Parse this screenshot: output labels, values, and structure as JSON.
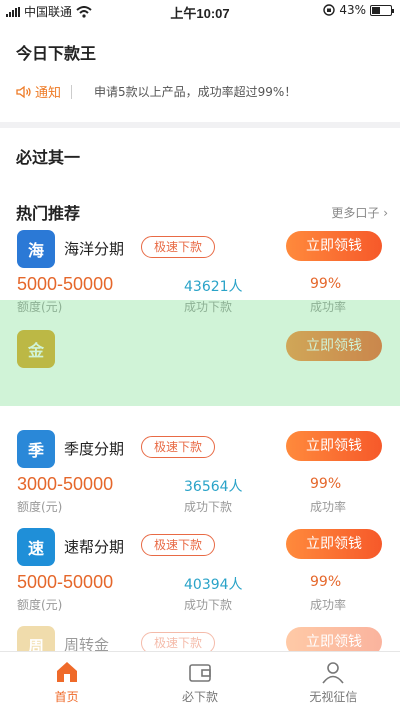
{
  "status": {
    "carrier": "中国联通",
    "time": "上午10:07",
    "battery": "43%",
    "battery_level": 0.43
  },
  "top": {
    "title": "今日下款王",
    "notice_label": "通知",
    "notice_text": "申请5款以上产品，成功率超过99%！"
  },
  "must": {
    "title": "必过其一"
  },
  "hot": {
    "title": "热门推荐",
    "more": "更多口子",
    "labels": {
      "amount": "额度(元)",
      "downloads": "成功下款",
      "rate": "成功率"
    },
    "products": [
      {
        "name": "海洋分期",
        "badge": "极速下款",
        "button": "立即领钱",
        "amount": "5000-50000",
        "downloads": "43621人",
        "rate": "99%",
        "logo_color": "#2b79d6",
        "logo_text": "海"
      },
      {
        "name": "",
        "badge": "",
        "button": "立即领钱",
        "amount": "",
        "downloads": "",
        "rate": "",
        "logo_color": "#e0a51f",
        "logo_text": "金"
      },
      {
        "name": "季度分期",
        "badge": "极速下款",
        "button": "立即领钱",
        "amount": "3000-50000",
        "downloads": "36564人",
        "rate": "99%",
        "logo_color": "#2a88d8",
        "logo_text": "季"
      },
      {
        "name": "速帮分期",
        "badge": "极速下款",
        "button": "立即领钱",
        "amount": "5000-50000",
        "downloads": "40394人",
        "rate": "99%",
        "logo_color": "#1f8fd8",
        "logo_text": "速"
      },
      {
        "name": "周转金",
        "badge": "极速下款",
        "button": "立即领钱",
        "amount": "",
        "downloads": "",
        "rate": "",
        "logo_color": "#e0b24a",
        "logo_text": "周"
      }
    ]
  },
  "tabs": [
    {
      "label": "首页",
      "icon": "home-icon"
    },
    {
      "label": "必下款",
      "icon": "wallet-icon"
    },
    {
      "label": "无视征信",
      "icon": "user-icon"
    }
  ],
  "colors": {
    "accent": "#ef6a2a",
    "downloads": "#2aa3c8"
  }
}
